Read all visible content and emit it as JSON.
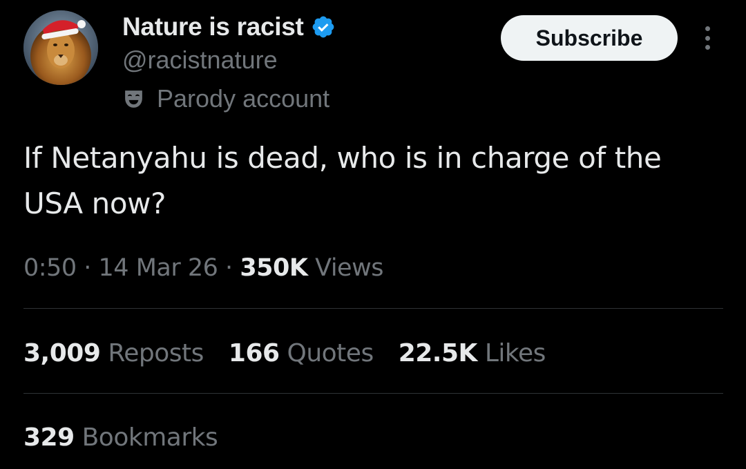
{
  "author": {
    "display_name": "Nature is racist",
    "handle": "@racistnature",
    "label": "Parody account",
    "verified": true,
    "verified_color": "#1d9bf0"
  },
  "header": {
    "subscribe_label": "Subscribe"
  },
  "tweet": {
    "text_line1": "If Netanyahu is dead, who is in charge of the",
    "text_line2": "USA now?"
  },
  "meta": {
    "time": "0:50",
    "separator": "·",
    "date": "14 Mar 26",
    "views_count": "350K",
    "views_label": "Views"
  },
  "stats": {
    "reposts_count": "3,009",
    "reposts_label": "Reposts",
    "quotes_count": "166",
    "quotes_label": "Quotes",
    "likes_count": "22.5K",
    "likes_label": "Likes",
    "bookmarks_count": "329",
    "bookmarks_label": "Bookmarks"
  },
  "icons": {
    "avatar": "lion-with-santa-hat-avatar",
    "verified": "verified-badge-icon",
    "parody": "theater-mask-icon",
    "more": "more-vertical-icon"
  },
  "colors": {
    "background": "#000000",
    "primary_text": "#e7e9ea",
    "secondary_text": "#71767b",
    "divider": "#2f3336",
    "button_bg": "#eff3f4",
    "button_text": "#0f1419"
  }
}
